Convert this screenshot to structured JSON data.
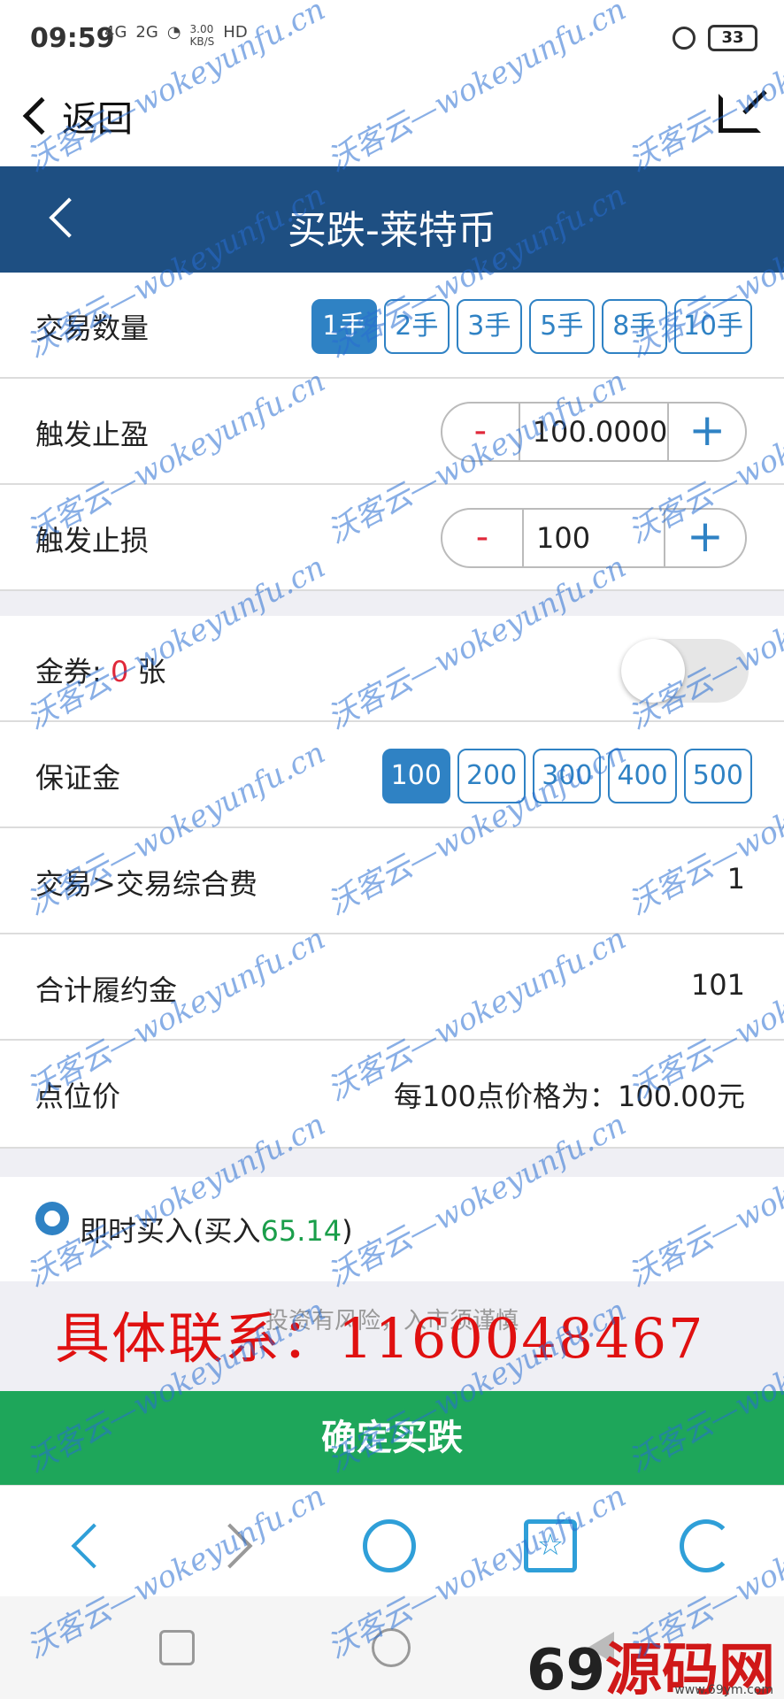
{
  "status_bar": {
    "time": "09:59",
    "net1": "4G",
    "net2": "2G",
    "speed_value": "3.00",
    "speed_unit": "KB/S",
    "hd": "HD",
    "battery": "33"
  },
  "browser": {
    "back_label": "返回"
  },
  "header": {
    "title": "买跌-莱特币"
  },
  "quantity": {
    "label": "交易数量",
    "options": [
      "1手",
      "2手",
      "3手",
      "5手",
      "8手",
      "10手"
    ],
    "selected": "1手"
  },
  "take_profit": {
    "label": "触发止盈",
    "minus": "-",
    "value": "100.0000",
    "plus": "+"
  },
  "stop_loss": {
    "label": "触发止损",
    "minus": "-",
    "value": "100",
    "plus": "+"
  },
  "coupon": {
    "label_prefix": "金券: ",
    "count": "0",
    "unit": " 张",
    "toggle_on": false
  },
  "margin": {
    "label": "保证金",
    "options": [
      "100",
      "200",
      "300",
      "400",
      "500"
    ],
    "selected": "100"
  },
  "fee": {
    "label": "交易>交易综合费",
    "value": "1"
  },
  "total": {
    "label": "合计履约金",
    "value": "101"
  },
  "point_price": {
    "label": "点位价",
    "value": "每100点价格为：100.00元"
  },
  "buy_mode": {
    "label_prefix": "即时买入(买入",
    "price": "65.14",
    "label_suffix": ")",
    "selected": true
  },
  "risk_notice": "投资有风险，入市须谨慎",
  "contact_overlay": "具体联系：1160048467",
  "confirm_button": "确定买跌",
  "watermark_text": "沃客云—wokeyunfu.cn",
  "site_mark": {
    "digits": "69",
    "name": "源码网",
    "url": "www.69ym.com"
  },
  "colors": {
    "header_bg": "#1e4f82",
    "accent_blue": "#2f82c4",
    "confirm_green": "#1ea65a",
    "red": "#e0283a",
    "price_green": "#1a9e4a"
  }
}
